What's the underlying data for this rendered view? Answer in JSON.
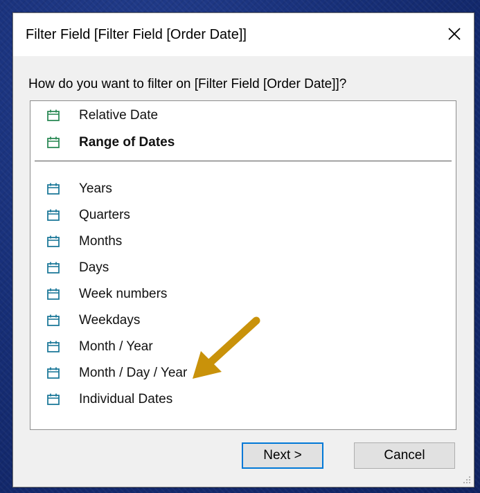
{
  "dialog": {
    "title": "Filter Field [Filter Field [Order Date]]",
    "prompt": "How do you want to filter on [Filter Field [Order Date]]?",
    "close_icon": "close-icon",
    "relative_items": [
      {
        "label": "Relative Date",
        "icon": "calendar-icon",
        "icon_color": "#2e8b57",
        "bold": false
      },
      {
        "label": "Range of Dates",
        "icon": "calendar-icon",
        "icon_color": "#2e8b57",
        "bold": true
      }
    ],
    "discrete_items": [
      {
        "label": "Years",
        "icon": "calendar-icon",
        "icon_color": "#1f7a9a"
      },
      {
        "label": "Quarters",
        "icon": "calendar-icon",
        "icon_color": "#1f7a9a"
      },
      {
        "label": "Months",
        "icon": "calendar-icon",
        "icon_color": "#1f7a9a"
      },
      {
        "label": "Days",
        "icon": "calendar-icon",
        "icon_color": "#1f7a9a"
      },
      {
        "label": "Week numbers",
        "icon": "calendar-icon",
        "icon_color": "#1f7a9a"
      },
      {
        "label": "Weekdays",
        "icon": "calendar-icon",
        "icon_color": "#1f7a9a"
      },
      {
        "label": "Month / Year",
        "icon": "calendar-icon",
        "icon_color": "#1f7a9a"
      },
      {
        "label": "Month / Day / Year",
        "icon": "calendar-icon",
        "icon_color": "#1f7a9a"
      },
      {
        "label": "Individual Dates",
        "icon": "calendar-icon",
        "icon_color": "#1f7a9a"
      }
    ],
    "buttons": {
      "next_label": "Next >",
      "cancel_label": "Cancel"
    }
  },
  "annotation": {
    "arrow_color": "#c9920a",
    "points_to": "Individual Dates"
  }
}
